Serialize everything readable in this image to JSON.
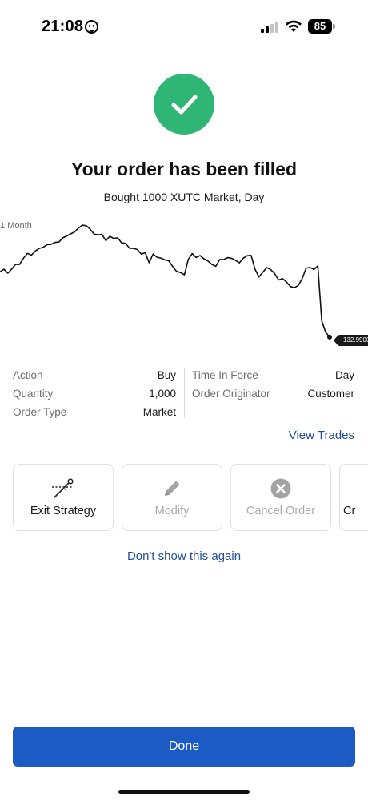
{
  "status_bar": {
    "time": "21:08",
    "battery": "85"
  },
  "success": {
    "icon": "checkmark-icon",
    "title": "Your order has been filled",
    "subtitle": "Bought 1000 XUTC Market, Day"
  },
  "chart": {
    "range_label": "1 Month",
    "last_price": "132.9900"
  },
  "chart_data": {
    "type": "line",
    "title": "",
    "xlabel": "",
    "ylabel": "",
    "range": "1 Month",
    "last_value": 132.99,
    "series": [
      {
        "name": "",
        "values": [
          138.63,
          138.81,
          138.55,
          138.99,
          139.19,
          139.26,
          139.89,
          140.09,
          140.02,
          140.46,
          140.77,
          140.66,
          140.97,
          141.07,
          141.04,
          141.15,
          141.6,
          141.84,
          141.81,
          142.06,
          142.48,
          142.52,
          142.55,
          142.34,
          142.0,
          141.74,
          141.84,
          141.39,
          141.57,
          141.46,
          141.6,
          141.25,
          141.0,
          140.66,
          140.73,
          140.42,
          140.11,
          140.32,
          139.54,
          140.07,
          139.89,
          139.89,
          139.54,
          139.54,
          139.13,
          138.79,
          138.48,
          138.37,
          139.79,
          140.07,
          139.82,
          140.07,
          139.87,
          139.47,
          139.26,
          139.19,
          139.57,
          139.64,
          139.89,
          139.92,
          139.54,
          139.4,
          139.89,
          139.89,
          140.0,
          138.89,
          138.3,
          138.51,
          139.0,
          138.9,
          138.35,
          137.88,
          138.09,
          137.88,
          137.27,
          137.25,
          137.53,
          137.9,
          138.89,
          139.05,
          138.95,
          139.05,
          134.38,
          133.5,
          132.99
        ]
      }
    ]
  },
  "details": {
    "left": [
      {
        "key": "Action",
        "value": "Buy"
      },
      {
        "key": "Quantity",
        "value": "1,000"
      },
      {
        "key": "Order Type",
        "value": "Market"
      }
    ],
    "right": [
      {
        "key": "Time In Force",
        "value": "Day"
      },
      {
        "key": "Order Originator",
        "value": "Customer"
      }
    ]
  },
  "links": {
    "view_trades": "View Trades",
    "dont_show": "Don't show this again"
  },
  "actions": [
    {
      "label": "Exit Strategy",
      "icon": "exit-strategy-icon",
      "enabled": true
    },
    {
      "label": "Modify",
      "icon": "pencil-icon",
      "enabled": false
    },
    {
      "label": "Cancel Order",
      "icon": "close-circle-icon",
      "enabled": false
    },
    {
      "label": "Cr",
      "icon": "",
      "enabled": true
    }
  ],
  "done_label": "Done",
  "colors": {
    "success_green": "#2fb675",
    "link_blue": "#1f4e9c",
    "primary_button": "#1c5bc4",
    "disabled_text": "#a9a9a9"
  }
}
